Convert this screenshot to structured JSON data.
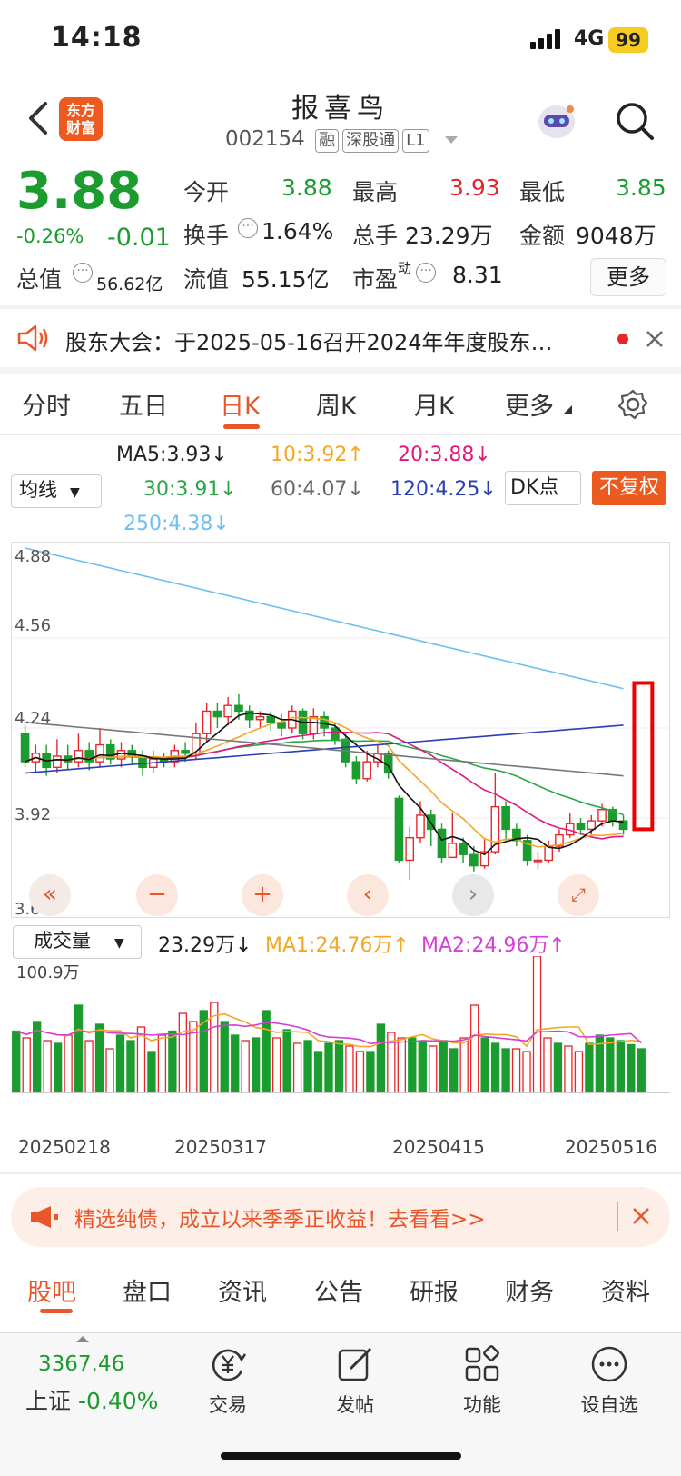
{
  "status_bar": {
    "time": "14:18",
    "network": "4G",
    "battery": "99"
  },
  "header": {
    "logo_line1": "东方",
    "logo_line2": "财富",
    "stock_name": "报喜鸟",
    "code": "002154",
    "tags": [
      "融",
      "深股通",
      "L1"
    ]
  },
  "quote": {
    "price": "3.88",
    "change_pct": "-0.26%",
    "change": "-0.01",
    "open_label": "今开",
    "open": "3.88",
    "high_label": "最高",
    "high": "3.93",
    "low_label": "最低",
    "low": "3.85",
    "turnover_label": "换手",
    "turnover": "1.64%",
    "volume_label": "总手",
    "volume": "23.29万",
    "amount_label": "金额",
    "amount": "9048万",
    "mcap_label": "总值",
    "mcap": "56.62亿",
    "float_label": "流值",
    "float_cap": "55.15亿",
    "pe_label": "市盈",
    "pe_sup": "动",
    "pe": "8.31",
    "more_label": "更多"
  },
  "notice": {
    "text": "股东大会：于2025-05-16召开2024年年度股东…"
  },
  "period_tabs": [
    "分时",
    "五日",
    "日K",
    "周K",
    "月K",
    "更多"
  ],
  "ma_legend": {
    "selector": "均线",
    "ma5": "MA5:3.93↓",
    "ma10": "10:3.92↑",
    "ma20": "20:3.88↓",
    "ma30": "30:3.91↓",
    "ma60": "60:4.07↓",
    "ma120": "120:4.25↓",
    "ma250": "250:4.38↓",
    "dk": "DK点",
    "fq": "不复权"
  },
  "colors": {
    "up": "#e5262b",
    "down": "#1a9c2e",
    "ma5": "#111111",
    "ma10": "#f5a623",
    "ma20": "#e0197d",
    "ma30": "#28a745",
    "ma60": "#777777",
    "ma120": "#2b3fb5",
    "ma250": "#6cc0f0",
    "accent": "#ec5a1f"
  },
  "price_axis": [
    "4.88",
    "4.56",
    "4.24",
    "3.92",
    "3.60"
  ],
  "volume_legend": {
    "selector": "成交量",
    "vol": "23.29万↓",
    "ma1": "MA1:24.76万↑",
    "ma2": "MA2:24.96万↑",
    "max": "100.9万"
  },
  "dates": [
    "20250218",
    "20250317",
    "20250415",
    "20250516"
  ],
  "chart_data": {
    "type": "candlestick",
    "ylim": [
      3.6,
      4.88
    ],
    "candles": [
      [
        4.22,
        4.12,
        4.25,
        4.1
      ],
      [
        4.12,
        4.15,
        4.18,
        4.08
      ],
      [
        4.15,
        4.1,
        4.18,
        4.07
      ],
      [
        4.1,
        4.14,
        4.2,
        4.08
      ],
      [
        4.14,
        4.12,
        4.18,
        4.09
      ],
      [
        4.12,
        4.16,
        4.22,
        4.1
      ],
      [
        4.16,
        4.12,
        4.19,
        4.09
      ],
      [
        4.12,
        4.18,
        4.24,
        4.1
      ],
      [
        4.18,
        4.13,
        4.2,
        4.11
      ],
      [
        4.13,
        4.16,
        4.19,
        4.1
      ],
      [
        4.16,
        4.14,
        4.18,
        4.11
      ],
      [
        4.14,
        4.1,
        4.16,
        4.07
      ],
      [
        4.1,
        4.13,
        4.16,
        4.08
      ],
      [
        4.13,
        4.12,
        4.15,
        4.1
      ],
      [
        4.12,
        4.16,
        4.18,
        4.1
      ],
      [
        4.16,
        4.15,
        4.19,
        4.12
      ],
      [
        4.15,
        4.22,
        4.26,
        4.13
      ],
      [
        4.22,
        4.3,
        4.33,
        4.19
      ],
      [
        4.3,
        4.28,
        4.33,
        4.24
      ],
      [
        4.28,
        4.32,
        4.35,
        4.25
      ],
      [
        4.32,
        4.3,
        4.36,
        4.27
      ],
      [
        4.3,
        4.27,
        4.32,
        4.24
      ],
      [
        4.27,
        4.28,
        4.3,
        4.24
      ],
      [
        4.28,
        4.26,
        4.3,
        4.23
      ],
      [
        4.26,
        4.24,
        4.29,
        4.21
      ],
      [
        4.24,
        4.3,
        4.32,
        4.22
      ],
      [
        4.3,
        4.22,
        4.31,
        4.2
      ],
      [
        4.22,
        4.28,
        4.31,
        4.2
      ],
      [
        4.28,
        4.24,
        4.3,
        4.21
      ],
      [
        4.24,
        4.2,
        4.26,
        4.18
      ],
      [
        4.2,
        4.12,
        4.22,
        4.1
      ],
      [
        4.12,
        4.06,
        4.14,
        4.04
      ],
      [
        4.06,
        4.12,
        4.16,
        4.05
      ],
      [
        4.12,
        4.15,
        4.18,
        4.1
      ],
      [
        4.15,
        4.08,
        4.16,
        4.06
      ],
      [
        3.99,
        3.77,
        4.0,
        3.76
      ],
      [
        3.77,
        3.85,
        3.89,
        3.7
      ],
      [
        3.85,
        3.93,
        3.98,
        3.83
      ],
      [
        3.93,
        3.88,
        3.95,
        3.82
      ],
      [
        3.88,
        3.78,
        3.9,
        3.76
      ],
      [
        3.78,
        3.83,
        3.94,
        3.78
      ],
      [
        3.83,
        3.79,
        3.85,
        3.76
      ],
      [
        3.79,
        3.75,
        3.82,
        3.73
      ],
      [
        3.75,
        3.8,
        3.85,
        3.74
      ],
      [
        3.8,
        3.96,
        4.08,
        3.79
      ],
      [
        3.96,
        3.88,
        3.98,
        3.84
      ],
      [
        3.88,
        3.84,
        3.9,
        3.82
      ],
      [
        3.84,
        3.77,
        3.86,
        3.75
      ],
      [
        3.77,
        3.77,
        3.8,
        3.74
      ],
      [
        3.77,
        3.82,
        3.84,
        3.76
      ],
      [
        3.82,
        3.86,
        3.88,
        3.8
      ],
      [
        3.86,
        3.9,
        3.94,
        3.85
      ],
      [
        3.9,
        3.88,
        3.92,
        3.86
      ],
      [
        3.88,
        3.91,
        3.93,
        3.86
      ],
      [
        3.91,
        3.95,
        3.97,
        3.89
      ],
      [
        3.95,
        3.91,
        3.96,
        3.89
      ],
      [
        3.91,
        3.88,
        3.93,
        3.86
      ]
    ],
    "volumes": [
      45,
      40,
      52,
      38,
      36,
      42,
      64,
      38,
      50,
      32,
      42,
      38,
      48,
      30,
      42,
      45,
      58,
      52,
      60,
      66,
      52,
      42,
      38,
      40,
      60,
      40,
      46,
      36,
      38,
      30,
      36,
      38,
      34,
      30,
      30,
      50,
      44,
      40,
      40,
      38,
      34,
      38,
      32,
      40,
      64,
      40,
      36,
      32,
      32,
      30,
      100,
      40,
      36,
      34,
      30,
      36,
      42,
      40,
      38,
      35,
      32
    ],
    "volume_max_label": "100.9万"
  },
  "promo": {
    "text": "精选纯债，成立以来季季正收益！去看看>>"
  },
  "bottom_tabs": [
    "股吧",
    "盘口",
    "资讯",
    "公告",
    "研报",
    "财务",
    "资料"
  ],
  "footer": {
    "index_value": "3367.46",
    "index_label": "上证",
    "index_change": "-0.40%",
    "items": [
      "交易",
      "发帖",
      "功能",
      "设自选"
    ]
  }
}
